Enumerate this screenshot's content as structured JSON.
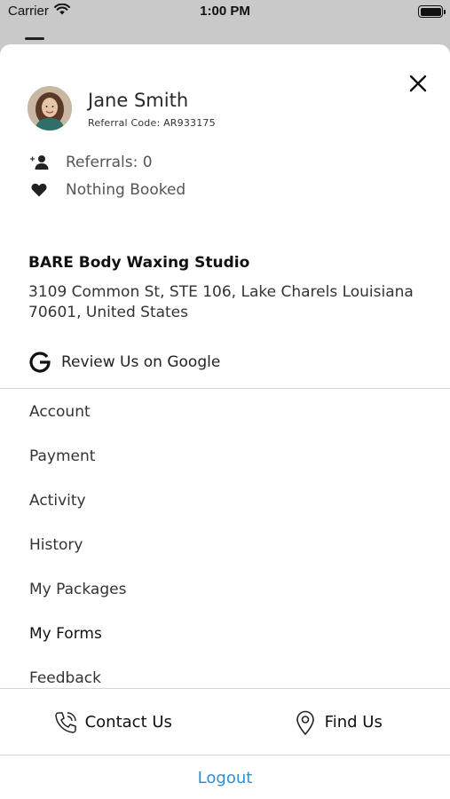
{
  "status_bar": {
    "carrier": "Carrier",
    "time": "1:00 PM"
  },
  "profile": {
    "name": "Jane Smith",
    "referral_code": "Referral Code: AR933175"
  },
  "stats": {
    "referrals": "Referrals: 0",
    "booked": "Nothing Booked"
  },
  "studio": {
    "name": "BARE Body Waxing Studio",
    "address": "3109 Common St, STE 106, Lake Charels Louisiana 70601, United States",
    "review_label": "Review Us on Google"
  },
  "menu": {
    "items": [
      {
        "label": "Account"
      },
      {
        "label": "Payment"
      },
      {
        "label": "Activity"
      },
      {
        "label": "History"
      },
      {
        "label": "My Packages"
      },
      {
        "label": "My Forms"
      },
      {
        "label": "Feedback"
      }
    ]
  },
  "footer": {
    "contact_label": "Contact Us",
    "find_label": "Find Us",
    "logout_label": "Logout"
  },
  "colors": {
    "accent": "#2e8fd8",
    "divider": "#d6d6d6"
  }
}
